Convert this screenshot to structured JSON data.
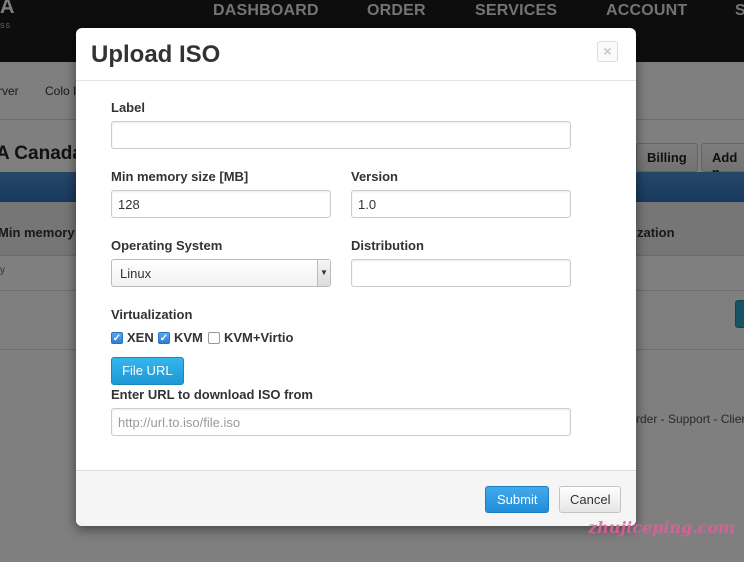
{
  "background": {
    "brand_letter": "A",
    "brand_sub": "ss",
    "nav": [
      "DASHBOARD",
      "ORDER",
      "SERVICES",
      "ACCOUNT",
      "S"
    ],
    "subnav": [
      "rver",
      "Colo I"
    ],
    "page_title": "A Canada",
    "tabs": [
      "Billing",
      "Add n"
    ],
    "table_headers": [
      "Min memory",
      "zation"
    ],
    "row_small": "y",
    "footer_links": "rder - Support - Clier",
    "watermark": "zhujiceping.com"
  },
  "modal": {
    "title": "Upload ISO",
    "close_glyph": "×",
    "label_field": {
      "label": "Label",
      "value": ""
    },
    "min_memory": {
      "label": "Min memory size [MB]",
      "value": "128"
    },
    "version": {
      "label": "Version",
      "value": "1.0"
    },
    "operating_system": {
      "label": "Operating System",
      "value": "Linux"
    },
    "distribution": {
      "label": "Distribution",
      "value": ""
    },
    "virtualization": {
      "label": "Virtualization",
      "options": [
        {
          "label": "XEN",
          "checked": true
        },
        {
          "label": "KVM",
          "checked": true
        },
        {
          "label": "KVM+Virtio",
          "checked": false
        }
      ]
    },
    "file_url_button": "File URL",
    "url_field": {
      "label": "Enter URL to download ISO from",
      "placeholder": "http://url.to.iso/file.iso",
      "value": ""
    },
    "submit": "Submit",
    "cancel": "Cancel"
  },
  "colors": {
    "accent": "#1f8fd8",
    "overlay": "rgba(0,0,0,0.5)",
    "topbar": "#1a1a1a",
    "band": "#2f74bd"
  }
}
